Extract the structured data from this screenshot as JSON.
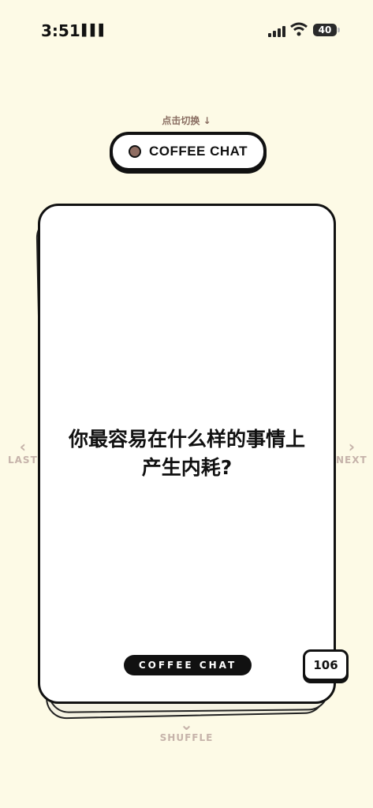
{
  "status_bar": {
    "time": "3:51",
    "time_suffix_icon": "book-icon",
    "battery": "40"
  },
  "header": {
    "switch_hint": "点击切换 ↓",
    "mode_label": "COFFEE CHAT",
    "mode_dot_color": "#8f6d62"
  },
  "card": {
    "question_line1": "你最容易在什么样的事情上",
    "question_line2": "产生内耗?",
    "tag": "COFFEE CHAT",
    "count": "106"
  },
  "nav": {
    "last": "LAST",
    "next": "NEXT",
    "shuffle": "SHUFFLE"
  },
  "colors": {
    "background": "#fdfae6",
    "accent": "#8f6d62",
    "nav": "#c6b3aa"
  }
}
